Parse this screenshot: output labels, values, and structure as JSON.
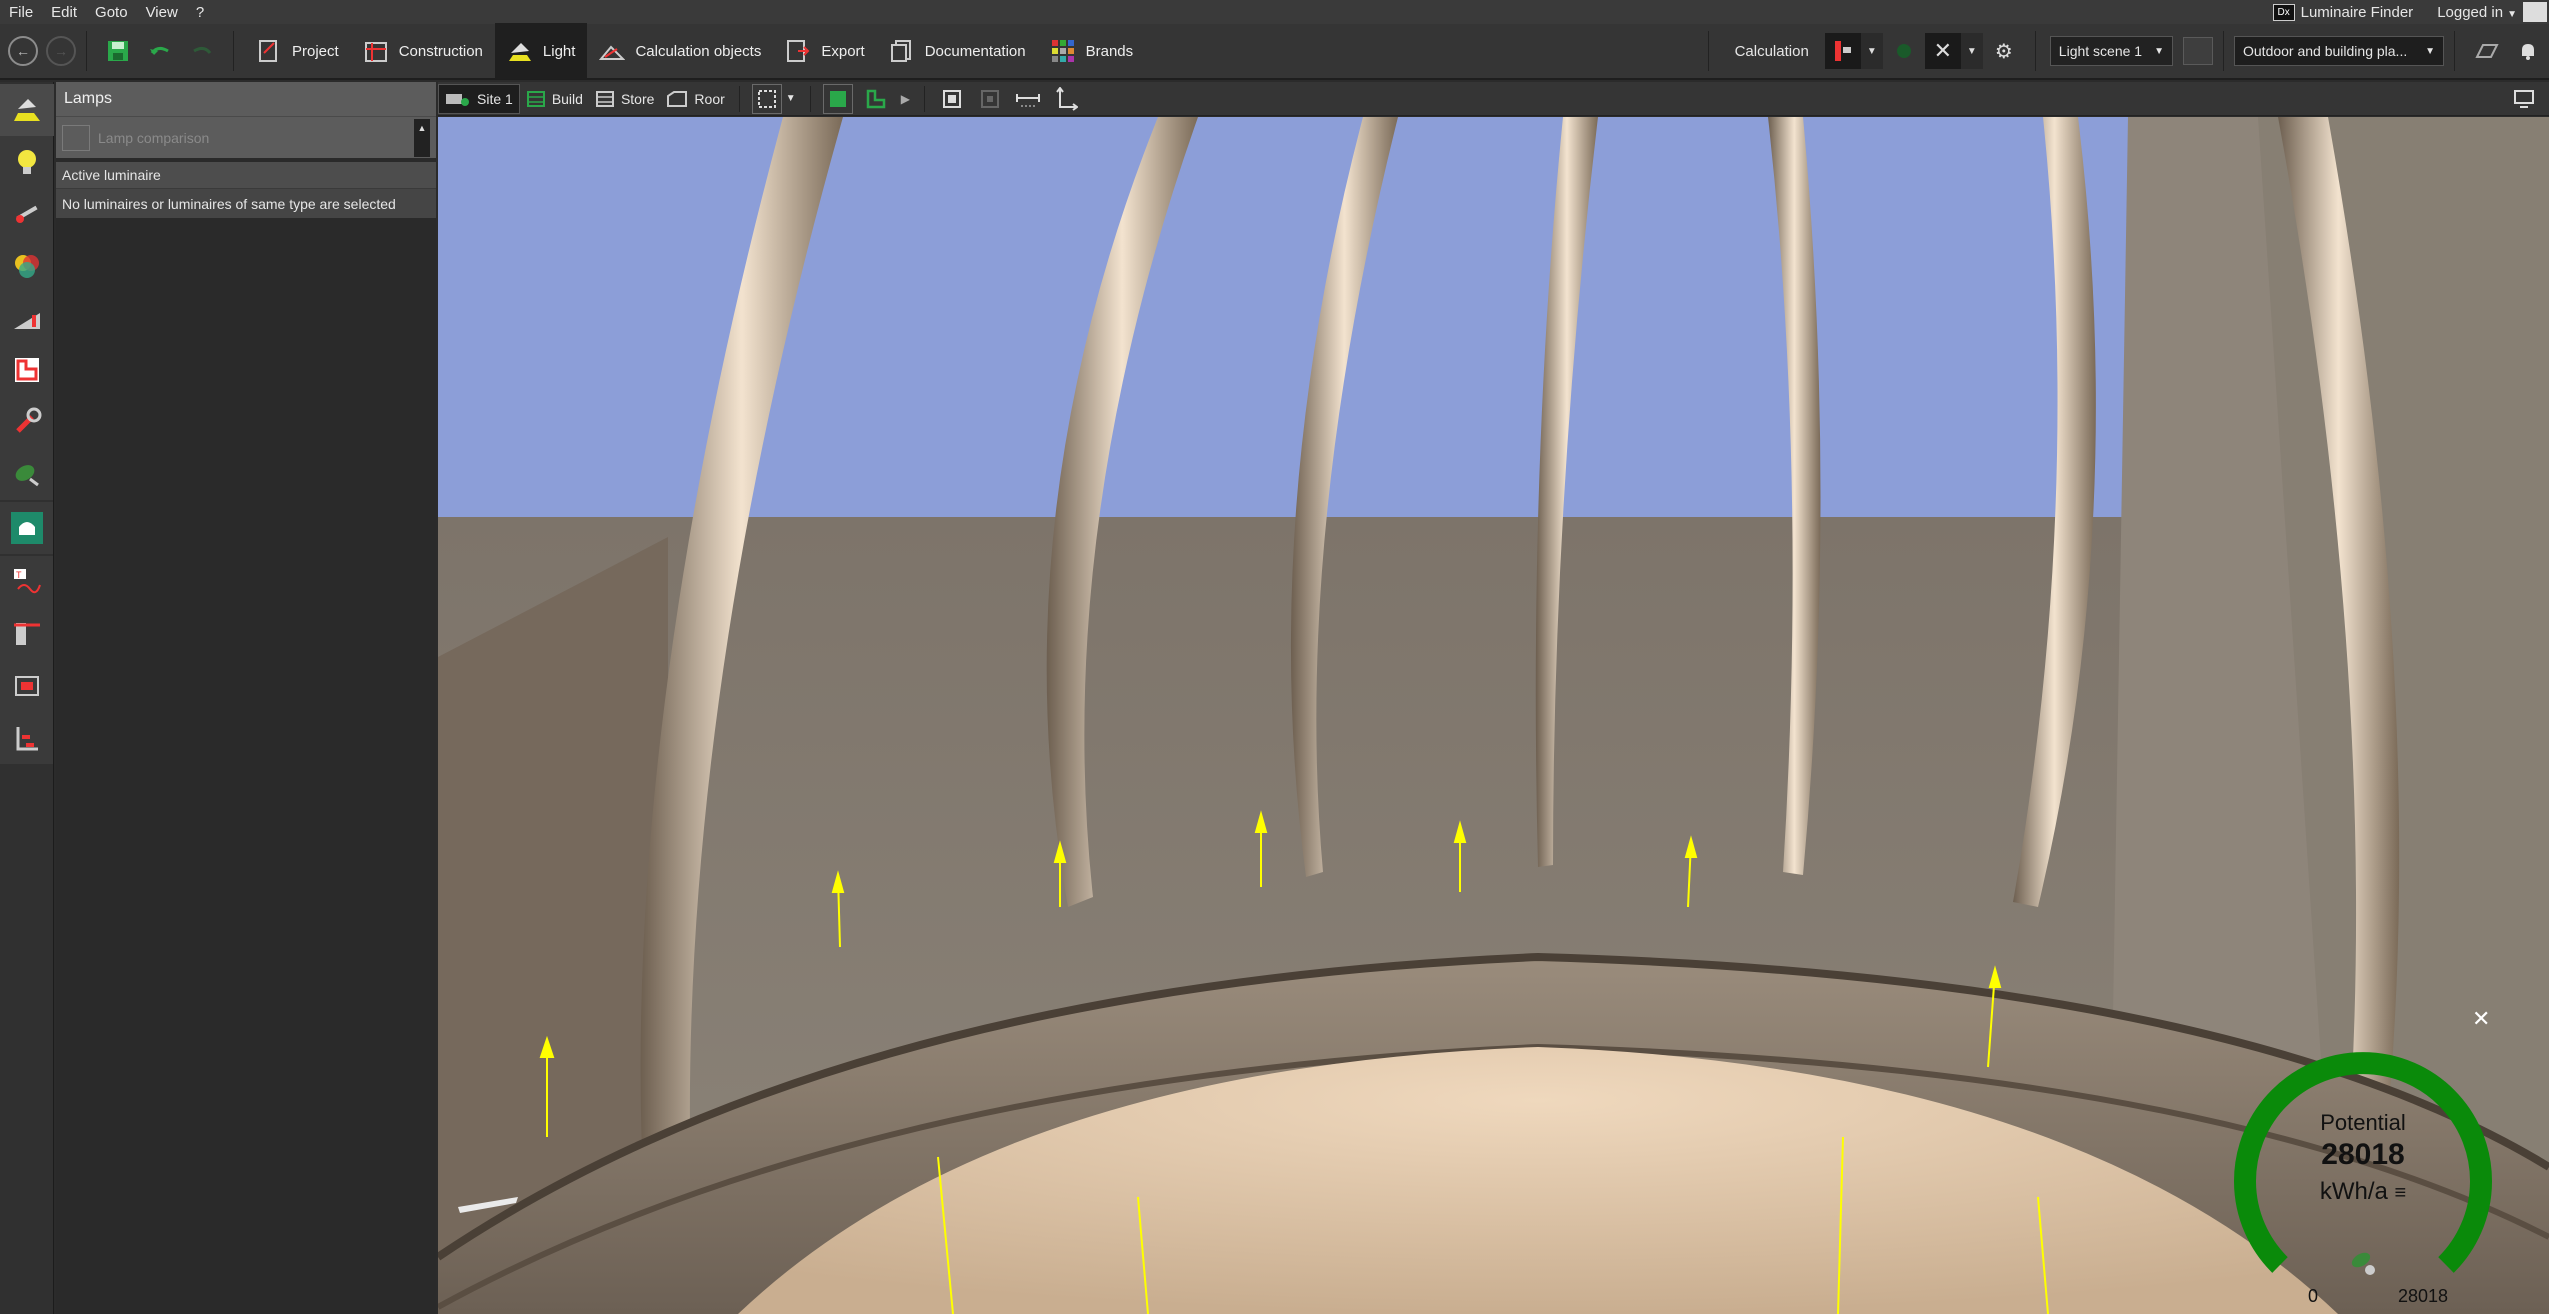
{
  "menu": [
    "File",
    "Edit",
    "Goto",
    "View",
    "?"
  ],
  "top_right": {
    "luminaire_finder_logo": "Dx",
    "luminaire_finder": "Luminaire Finder",
    "logged_in": "Logged in"
  },
  "toolbar": {
    "tabs": [
      {
        "label": "Project",
        "icon": "project-icon"
      },
      {
        "label": "Construction",
        "icon": "construction-icon"
      },
      {
        "label": "Light",
        "icon": "light-icon",
        "active": true
      },
      {
        "label": "Calculation objects",
        "icon": "calculation-objects-icon"
      },
      {
        "label": "Export",
        "icon": "export-icon"
      },
      {
        "label": "Documentation",
        "icon": "documentation-icon"
      },
      {
        "label": "Brands",
        "icon": "brands-icon"
      }
    ],
    "calculation_label": "Calculation",
    "light_scene": "Light scene 1",
    "outdoor_select": "Outdoor and building pla..."
  },
  "lamps_panel": {
    "title": "Lamps",
    "lamp_comparison": "Lamp comparison",
    "active_luminaire_header": "Active luminaire",
    "empty_message": "No luminaires or luminaires of same type are selected"
  },
  "viewport_toolbar": {
    "tabs": [
      {
        "label": "Site 1",
        "active": true
      },
      {
        "label": "Build",
        "active": false
      },
      {
        "label": "Store",
        "active": false
      },
      {
        "label": "Roor",
        "active": false
      }
    ]
  },
  "energy": {
    "label": "Potential",
    "value": "28018",
    "unit": "kWh/a",
    "min": "0",
    "max": "28018",
    "fill_fraction": 1.0,
    "color": "#0a8a0a"
  },
  "colors": {
    "sky": "#8c9ed8",
    "wall": "#837a70",
    "accent_green": "#0a8a0a",
    "light_vector": "#ffff00"
  }
}
